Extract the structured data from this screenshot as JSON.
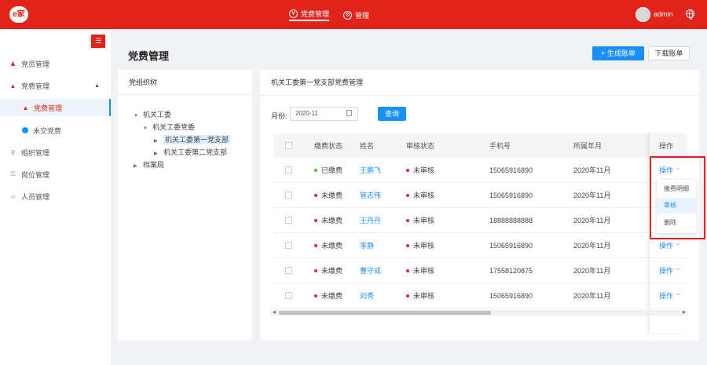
{
  "header": {
    "logo_text": "e家",
    "nav": [
      {
        "label": "党费管理",
        "icon": "yen-icon",
        "active": true
      },
      {
        "label": "管理",
        "icon": "gear-icon",
        "active": false
      }
    ],
    "username": "admin"
  },
  "sidebar": {
    "collapse_icon": "menu-collapse-icon",
    "items": [
      {
        "label": "党员管理"
      },
      {
        "label": "党费管理"
      },
      {
        "label": "党费管理"
      },
      {
        "label": "未交党费"
      },
      {
        "label": "组织管理"
      },
      {
        "label": "岗位管理"
      },
      {
        "label": "人员管理"
      }
    ]
  },
  "page": {
    "title": "党费管理",
    "generate_label": "+ 生成账单",
    "download_label": "下载账单"
  },
  "org_panel": {
    "title": "党组织树",
    "tree": [
      "机关工委",
      "机关工委党委",
      "机关工委第一党支部",
      "机关工委第二党支部",
      "档案局"
    ]
  },
  "main": {
    "breadcrumb": "机关工委第一党支部党费管理",
    "month_label": "月份:",
    "month_value": "2020-11",
    "query_label": "查询",
    "columns": [
      "缴费状态",
      "姓名",
      "审核状态",
      "手机号",
      "所属年月",
      "操作"
    ],
    "rows": [
      {
        "pay_status": "已缴费",
        "pay_color": "#52c41a",
        "name": "王鹏飞",
        "audit": "未审核",
        "phone": "15065916890",
        "month": "2020年11月",
        "op": "操作"
      },
      {
        "pay_status": "未缴费",
        "pay_color": "#f5222d",
        "name": "管志伟",
        "audit": "未审核",
        "phone": "15065916890",
        "month": "2020年11月",
        "op": "操作"
      },
      {
        "pay_status": "未缴费",
        "pay_color": "#f5222d",
        "name": "王丹丹",
        "audit": "未审核",
        "phone": "18888888888",
        "month": "2020年11月",
        "op": "操作"
      },
      {
        "pay_status": "未缴费",
        "pay_color": "#f5222d",
        "name": "李静",
        "audit": "未审核",
        "phone": "15065916890",
        "month": "2020年11月",
        "op": "操作"
      },
      {
        "pay_status": "未缴费",
        "pay_color": "#f5222d",
        "name": "曹守成",
        "audit": "未审核",
        "phone": "17558120875",
        "month": "2020年11月",
        "op": "操作"
      },
      {
        "pay_status": "未缴费",
        "pay_color": "#f5222d",
        "name": "刘秀",
        "audit": "未审核",
        "phone": "15065916890",
        "month": "2020年11月",
        "op": "操作"
      }
    ],
    "dropdown": [
      "缴费明细",
      "审核",
      "删除"
    ]
  },
  "colors": {
    "brand": "#e2231a",
    "accent": "#1890ff"
  }
}
